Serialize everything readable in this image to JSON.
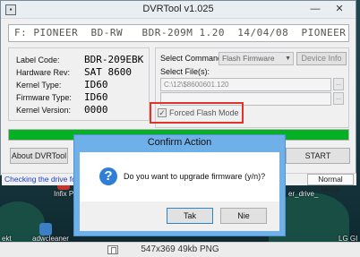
{
  "window": {
    "title": "DVRTool v1.025",
    "minimize_glyph": "—",
    "close_glyph": "✕",
    "drive_line": "F: PIONEER  BD-RW   BDR-209M 1.20  14/04/08  PIONEER",
    "info": [
      {
        "label": "Label Code:",
        "value": "BDR-209EBK"
      },
      {
        "label": "Hardware Rev:",
        "value": "SAT 8600"
      },
      {
        "label": "Kernel Type:",
        "value": "ID60"
      },
      {
        "label": "Firmware Type:",
        "value": "ID60"
      },
      {
        "label": "Kernel Version:",
        "value": "0000"
      }
    ],
    "command": {
      "select_label": "Select Command:",
      "select_value": "Flash Firmware",
      "device_info_button": "Device Info",
      "files_label": "Select File(s):",
      "file1_value": "C:\\12\\$8600601.120",
      "file2_value": "",
      "browse_glyph": "..."
    },
    "forced_flash": {
      "label": "Forced Flash Mode",
      "checked": true,
      "check_glyph": "✓"
    },
    "progress_percent": 100,
    "about_button": "About DVRTool",
    "start_button": "START",
    "status_text": "Checking the drive fo",
    "status_mode": "Normal Mode"
  },
  "dialog": {
    "title": "Confirm Action",
    "icon_glyph": "?",
    "message": "Do you want to upgrade firmware (y/n)?",
    "yes_button": "Tak",
    "no_button": "Nie"
  },
  "desktop": {
    "label_infix": "Infix PDF E",
    "label_driver": "er_drive_",
    "label_ekt": "ekt",
    "label_adwcleaner": "adwcleaner",
    "label_lg": "LG GI"
  },
  "caption": {
    "text": "547x369 49kb PNG"
  },
  "colors": {
    "progress": "#06b025",
    "highlight": "#e0332c",
    "dialog_frame": "#6fb0e8",
    "status_text": "#1a3ec8"
  }
}
